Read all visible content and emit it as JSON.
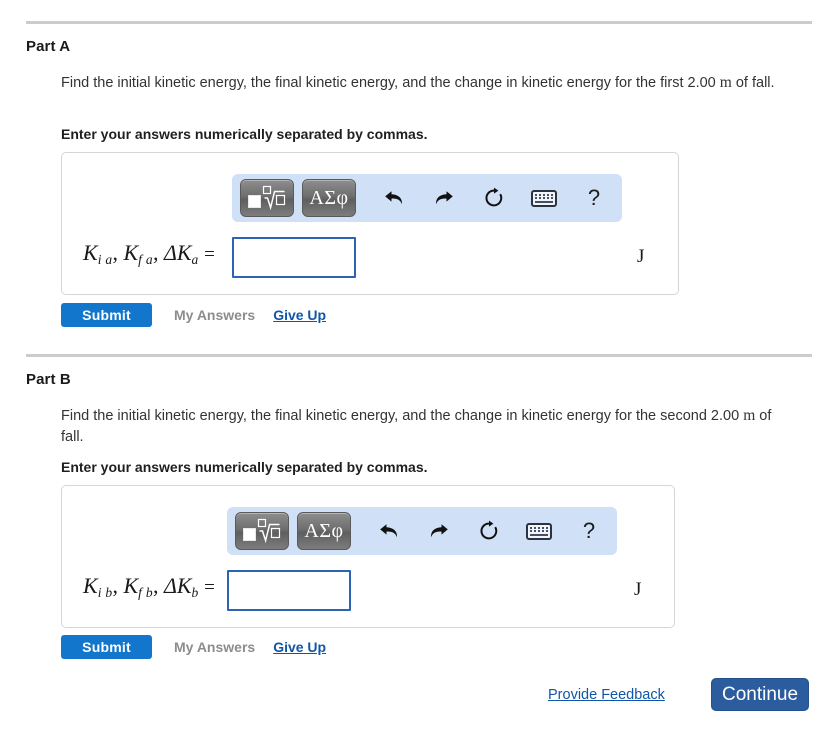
{
  "parts": [
    {
      "heading": "Part A",
      "prompt_text": "Find the initial kinetic energy, the final kinetic energy, and the change in kinetic energy for the first 2.00 ",
      "prompt_unit": "m",
      "prompt_tail": " of fall.",
      "instruction": "Enter your answers numerically separated by commas.",
      "formula": {
        "k1": "K",
        "k1_sub": "i a",
        "comma1": ",",
        "k2": "K",
        "k2_sub": "f a",
        "comma2": ",",
        "delta": "ΔK",
        "delta_sub": "a",
        "equals": "="
      },
      "input_value": "",
      "unit": "J",
      "submit_label": "Submit",
      "my_answers_label": "My Answers",
      "give_up_label": "Give Up"
    },
    {
      "heading": "Part B",
      "prompt_text": "Find the initial kinetic energy, the final kinetic energy, and the change in kinetic energy for the second 2.00 ",
      "prompt_unit": "m",
      "prompt_tail": " of fall.",
      "instruction": "Enter your answers numerically separated by commas.",
      "formula": {
        "k1": "K",
        "k1_sub": "i b",
        "comma1": ",",
        "k2": "K",
        "k2_sub": "f b",
        "comma2": ",",
        "delta": "ΔK",
        "delta_sub": "b",
        "equals": "="
      },
      "input_value": "",
      "unit": "J",
      "submit_label": "Submit",
      "my_answers_label": "My Answers",
      "give_up_label": "Give Up"
    }
  ],
  "mathbar": {
    "template_button": "math-template",
    "greek_button": "ΑΣφ",
    "undo": "undo-icon",
    "redo": "redo-icon",
    "reset": "reset-icon",
    "keyboard": "keyboard-icon",
    "help": "?"
  },
  "footer": {
    "provide_feedback": "Provide Feedback",
    "continue_label": "Continue"
  },
  "colors": {
    "toolbar_bg": "#cfe0f7",
    "submit_blue": "#1276cd",
    "continue_blue": "#2b5c9e",
    "link_blue": "#1056a8",
    "input_border": "#2d63b5",
    "divider": "#cccccc",
    "muted_text": "#8d8d8d"
  }
}
